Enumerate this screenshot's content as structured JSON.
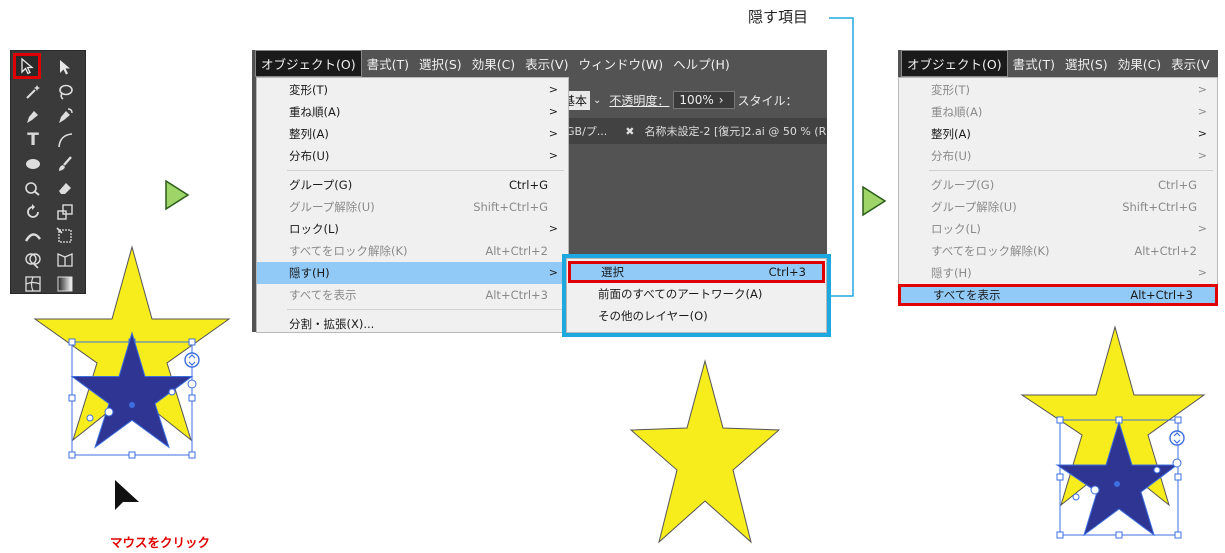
{
  "annotation": {
    "hidden_items_label": "隠す項目",
    "click_label": "マウスをクリック"
  },
  "colors": {
    "star_yellow": "#f7ec1c",
    "star_blue": "#2f3593",
    "highlight_red": "#e00000",
    "highlight_cyan": "#1ea8e0",
    "arrow_green": "#9ed468",
    "menu_highlight": "#91c9f7"
  },
  "menubar1": {
    "items": [
      "オブジェクト(O)",
      "書式(T)",
      "選択(S)",
      "効果(C)",
      "表示(V)",
      "ウィンドウ(W)",
      "ヘルプ(H)"
    ]
  },
  "control_bar": {
    "basic": "基本",
    "opacity_label": "不透明度：",
    "opacity_value": "100%",
    "style_label": "スタイル："
  },
  "doc_tabs": {
    "tab1": "GB/プ...",
    "tab2": "名称未設定-2 [復元]2.ai @ 50 % (R"
  },
  "object_menu": {
    "transform": "変形(T)",
    "arrange": "重ね順(A)",
    "align": "整列(A)",
    "distribute": "分布(U)",
    "group": "グループ(G)",
    "group_sc": "Ctrl+G",
    "ungroup": "グループ解除(U)",
    "ungroup_sc": "Shift+Ctrl+G",
    "lock": "ロック(L)",
    "unlock_all": "すべてをロック解除(K)",
    "unlock_all_sc": "Alt+Ctrl+2",
    "hide": "隠す(H)",
    "show_all": "すべてを表示",
    "show_all_sc": "Alt+Ctrl+3",
    "expand": "分割・拡張(X)..."
  },
  "hide_submenu": {
    "selection": "選択",
    "selection_sc": "Ctrl+3",
    "all_above": "前面のすべてのアートワーク(A)",
    "other_layers": "その他のレイヤー(O)"
  },
  "menubar2": {
    "items": [
      "オブジェクト(O)",
      "書式(T)",
      "選択(S)",
      "効果(C)",
      "表示(V"
    ]
  }
}
